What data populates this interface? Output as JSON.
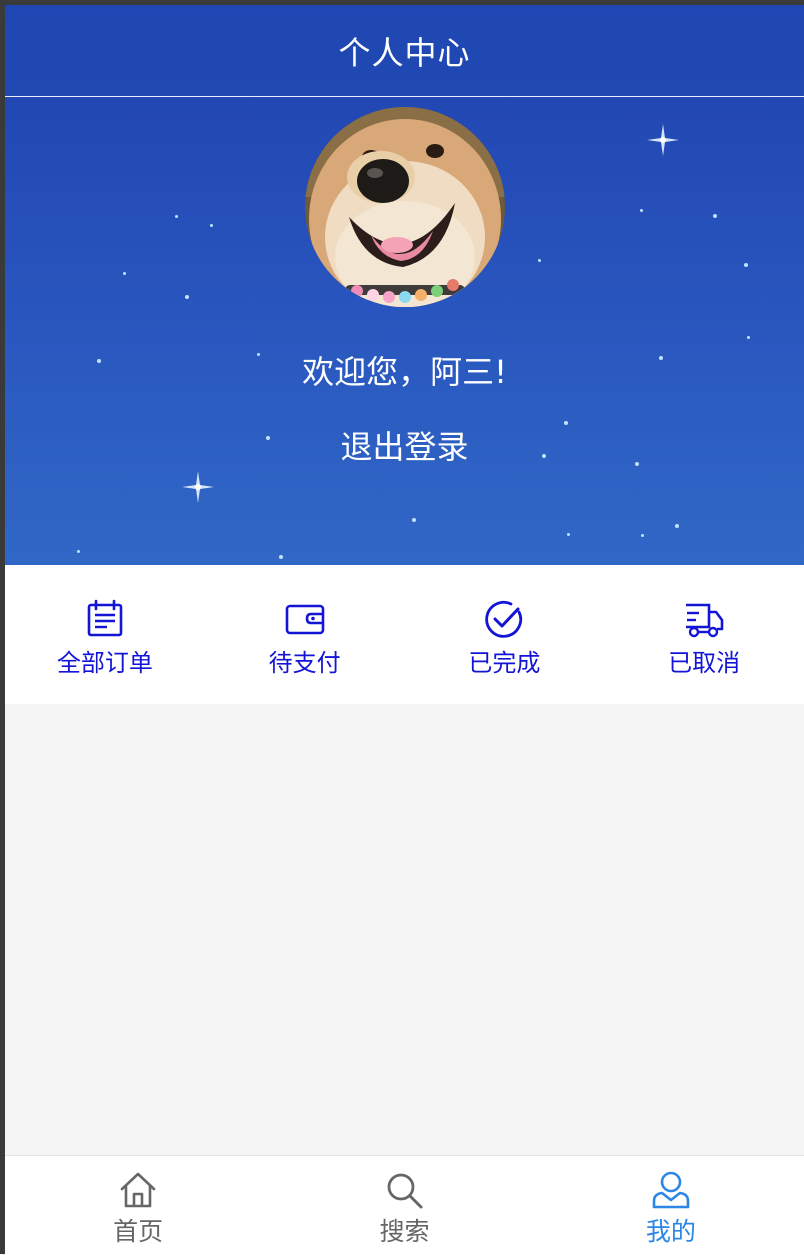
{
  "header": {
    "title": "个人中心"
  },
  "profile": {
    "greeting": "欢迎您，阿三!",
    "logout_label": "退出登录"
  },
  "orders": [
    {
      "label": "全部订单",
      "icon": "calendar-list-icon"
    },
    {
      "label": "待支付",
      "icon": "wallet-icon"
    },
    {
      "label": "已完成",
      "icon": "check-circle-icon"
    },
    {
      "label": "已取消",
      "icon": "truck-icon"
    }
  ],
  "tabbar": [
    {
      "label": "首页",
      "icon": "home-icon",
      "active": false
    },
    {
      "label": "搜索",
      "icon": "search-icon",
      "active": false
    },
    {
      "label": "我的",
      "icon": "user-icon",
      "active": true
    }
  ],
  "colors": {
    "header_bg": "#2149b2",
    "order_accent": "#1414d6",
    "tab_active": "#2b86e6",
    "tab_inactive": "#666666"
  }
}
